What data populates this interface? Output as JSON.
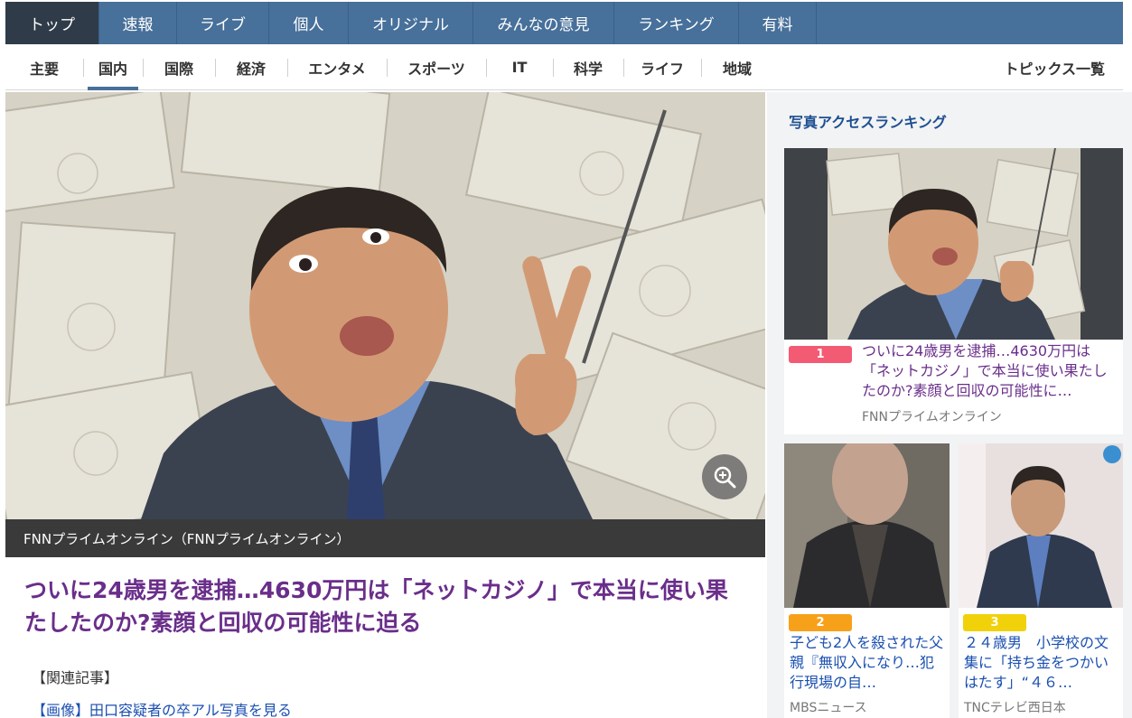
{
  "top_nav": {
    "tabs": [
      {
        "label": "トップ",
        "active": true
      },
      {
        "label": "速報",
        "active": false
      },
      {
        "label": "ライブ",
        "active": false
      },
      {
        "label": "個人",
        "active": false
      },
      {
        "label": "オリジナル",
        "active": false
      },
      {
        "label": "みんなの意見",
        "active": false
      },
      {
        "label": "ランキング",
        "active": false
      },
      {
        "label": "有料",
        "active": false
      }
    ]
  },
  "sub_nav": {
    "categories": [
      {
        "label": "主要",
        "active": false
      },
      {
        "label": "国内",
        "active": true
      },
      {
        "label": "国際",
        "active": false
      },
      {
        "label": "経済",
        "active": false
      },
      {
        "label": "エンタメ",
        "active": false
      },
      {
        "label": "スポーツ",
        "active": false
      },
      {
        "label": "IT",
        "active": false
      },
      {
        "label": "科学",
        "active": false
      },
      {
        "label": "ライフ",
        "active": false
      },
      {
        "label": "地域",
        "active": false
      }
    ],
    "topics_link": "トピックス一覧"
  },
  "article": {
    "image_caption": "FNNプライムオンライン（FNNプライムオンライン）",
    "zoom_icon": "zoom-in-icon",
    "headline": "ついに24歳男を逮捕…4630万円は「ネットカジノ」で本当に使い果たしたのか?素顔と回収の可能性に迫る",
    "related_label": "【関連記事】",
    "related_link": "【画像】田口容疑者の卒アル写真を見る"
  },
  "sidebar": {
    "title": "写真アクセスランキング",
    "items": [
      {
        "rank": "1",
        "title": "ついに24歳男を逮捕…4630万円は「ネットカジノ」で本当に使い果たしたのか?素顔と回収の可能性に…",
        "source": "FNNプライムオンライン",
        "rank_color": "#f35a73"
      },
      {
        "rank": "2",
        "title": "子ども2人を殺された父親『無収入になり…犯行現場の自…",
        "source": "MBSニュース",
        "rank_color": "#f7a11a"
      },
      {
        "rank": "3",
        "title": "２４歳男　小学校の文集に「持ち金をつかいはたす」“４６…",
        "source": "TNCテレビ西日本",
        "rank_color": "#f1d20a"
      }
    ]
  },
  "colors": {
    "nav_bg": "#47709a",
    "nav_active": "#2f3b48",
    "headline": "#6a2e8a",
    "link": "#1a4fb0"
  }
}
